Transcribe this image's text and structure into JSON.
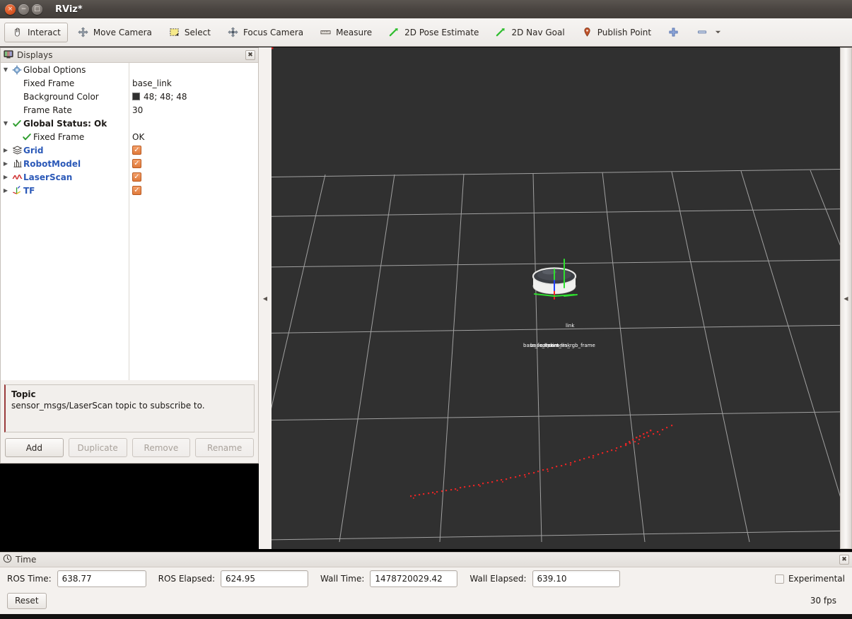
{
  "window": {
    "title": "RViz*",
    "buttons": {
      "close": "×",
      "minimize": "−",
      "maximize": "□"
    }
  },
  "toolbar": {
    "items": [
      {
        "label": "Interact",
        "icon": "hand-cursor-icon",
        "active": true
      },
      {
        "label": "Move Camera",
        "icon": "move-camera-icon",
        "active": false
      },
      {
        "label": "Select",
        "icon": "select-rect-icon",
        "active": false
      },
      {
        "label": "Focus Camera",
        "icon": "focus-camera-icon",
        "active": false
      },
      {
        "label": "Measure",
        "icon": "measure-ruler-icon",
        "active": false
      },
      {
        "label": "2D Pose Estimate",
        "icon": "pose-arrow-icon",
        "active": false
      },
      {
        "label": "2D Nav Goal",
        "icon": "nav-goal-arrow-icon",
        "active": false
      },
      {
        "label": "Publish Point",
        "icon": "map-pin-icon",
        "active": false
      }
    ],
    "add_tool_icon": "plus-icon",
    "remove_tool_icon": "minus-icon",
    "overflow_icon": "chevron-down-icon"
  },
  "displays_panel": {
    "title": "Displays",
    "title_icon": "monitor-icon",
    "close_icon": "close-icon",
    "tree": [
      {
        "name": "Global Options",
        "icon": "gear-icon",
        "expander": "▼",
        "value": "",
        "value_type": "none",
        "style": "plain",
        "indent": 0
      },
      {
        "name": "Fixed Frame",
        "icon": "",
        "expander": "",
        "value": "base_link",
        "value_type": "text",
        "style": "plain",
        "indent": 1
      },
      {
        "name": "Background Color",
        "icon": "",
        "expander": "",
        "value": "48; 48; 48",
        "value_type": "color",
        "color": "#303030",
        "style": "plain",
        "indent": 1
      },
      {
        "name": "Frame Rate",
        "icon": "",
        "expander": "",
        "value": "30",
        "value_type": "text",
        "style": "plain",
        "indent": 1
      },
      {
        "name": "Global Status: Ok",
        "icon": "check-icon",
        "expander": "▼",
        "value": "",
        "value_type": "none",
        "style": "bold",
        "indent": 0
      },
      {
        "name": "Fixed Frame",
        "icon": "check-icon",
        "expander": "",
        "value": "OK",
        "value_type": "text",
        "style": "plain",
        "indent": 2
      },
      {
        "name": "Grid",
        "icon": "grid-icon",
        "expander": "▶",
        "value": "checked",
        "value_type": "checkbox",
        "style": "link",
        "indent": 0
      },
      {
        "name": "RobotModel",
        "icon": "robot-icon",
        "expander": "▶",
        "value": "checked",
        "value_type": "checkbox",
        "style": "link",
        "indent": 0
      },
      {
        "name": "LaserScan",
        "icon": "laserscan-icon",
        "expander": "▶",
        "value": "checked",
        "value_type": "checkbox",
        "style": "link",
        "indent": 0
      },
      {
        "name": "TF",
        "icon": "tf-axes-icon",
        "expander": "▶",
        "value": "checked",
        "value_type": "checkbox",
        "style": "link",
        "indent": 0
      }
    ],
    "help": {
      "title": "Topic",
      "description": "sensor_msgs/LaserScan topic to subscribe to."
    },
    "buttons": [
      {
        "label": "Add",
        "enabled": true
      },
      {
        "label": "Duplicate",
        "enabled": false
      },
      {
        "label": "Remove",
        "enabled": false
      },
      {
        "label": "Rename",
        "enabled": false
      }
    ]
  },
  "viewport": {
    "background_color": "#303030",
    "grid_color": "#b4b4b4",
    "laser_color": "#e02020",
    "robot_frames": [
      {
        "label": "base_footprint"
      },
      {
        "label": "base_link"
      },
      {
        "label": "camera_link"
      },
      {
        "label": "camera_rgb_frame"
      },
      {
        "label": "link"
      }
    ],
    "axis_colors": {
      "x": "#ff2020",
      "y": "#20e020",
      "z": "#2040ff"
    },
    "collapse_left_icon": "collapse-left-icon",
    "collapse_right_icon": "collapse-right-icon"
  },
  "time_panel": {
    "title": "Time",
    "title_icon": "clock-icon",
    "close_icon": "close-icon",
    "fields": [
      {
        "label": "ROS Time:",
        "value": "638.77"
      },
      {
        "label": "ROS Elapsed:",
        "value": "624.95"
      },
      {
        "label": "Wall Time:",
        "value": "1478720029.42"
      },
      {
        "label": "Wall Elapsed:",
        "value": "639.10"
      }
    ],
    "experimental": {
      "label": "Experimental",
      "checked": false
    },
    "reset_label": "Reset",
    "fps": "30 fps"
  }
}
